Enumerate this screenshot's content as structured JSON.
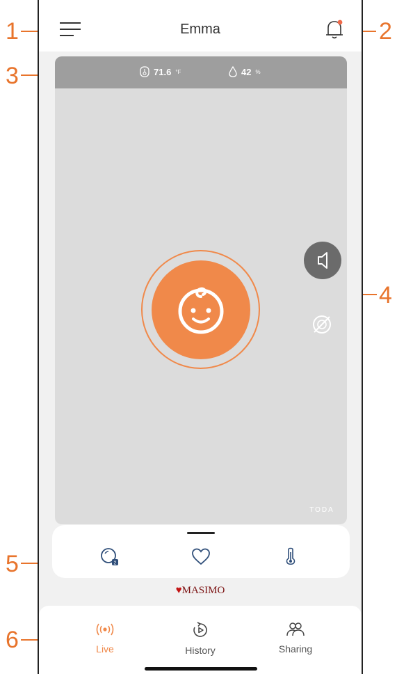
{
  "callouts": [
    "1",
    "2",
    "3",
    "4",
    "5",
    "6"
  ],
  "header": {
    "title": "Emma",
    "menu_icon": "hamburger-menu-icon",
    "notification_icon": "bell-icon"
  },
  "environment": {
    "temperature": "71.6",
    "temperature_unit": "°F",
    "humidity": "42",
    "humidity_unit": "%"
  },
  "camera": {
    "watermark": "TODA",
    "center_icon": "baby-face-icon",
    "side_controls": [
      "speaker-icon",
      "mic-off-icon"
    ]
  },
  "vitals_sheet": {
    "icons": [
      "oxygen-saturation-icon",
      "heart-icon",
      "thermometer-icon"
    ]
  },
  "brand": {
    "mark": "♥",
    "name": "MASIMO"
  },
  "nav": {
    "items": [
      {
        "label": "Live",
        "icon": "live-broadcast-icon",
        "active": true
      },
      {
        "label": "History",
        "icon": "history-icon",
        "active": false
      },
      {
        "label": "Sharing",
        "icon": "people-icon",
        "active": false
      }
    ]
  },
  "colors": {
    "accent": "#f0894a",
    "callout": "#e8742c",
    "env_bar": "#9e9e9e",
    "camera_bg": "#dcdcdc"
  }
}
